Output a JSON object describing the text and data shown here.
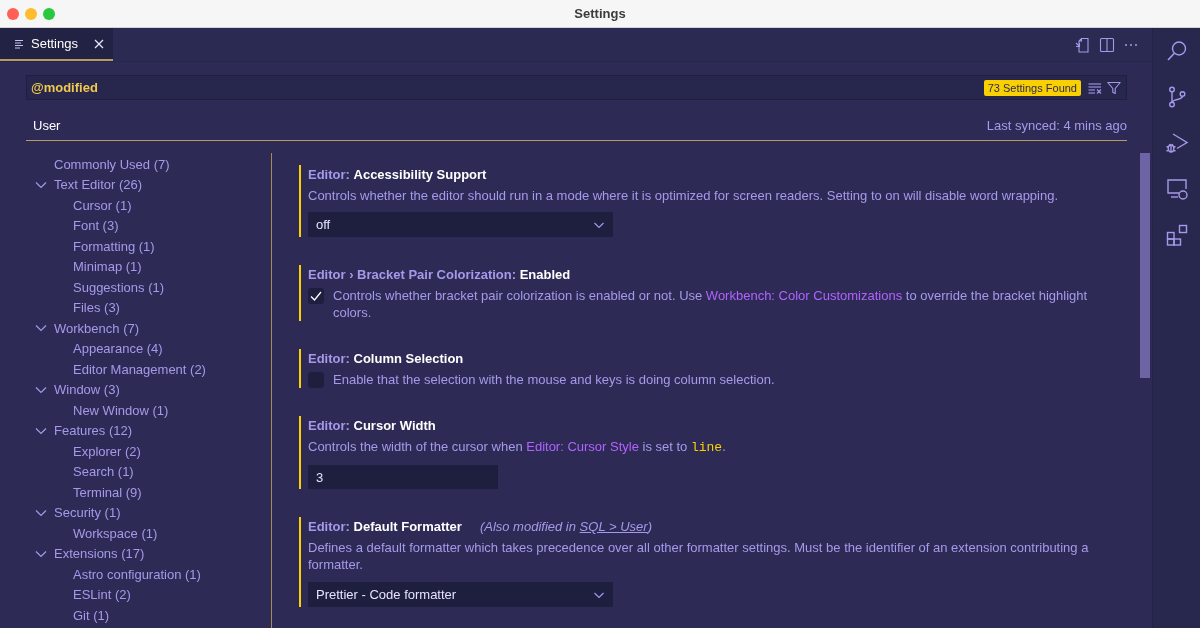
{
  "window": {
    "title": "Settings"
  },
  "tabs": [
    {
      "label": "Settings",
      "selected": true
    }
  ],
  "search": {
    "value": "@modified",
    "badge": "73 Settings Found"
  },
  "scope_tabs": [
    {
      "label": "User",
      "selected": true
    }
  ],
  "sync_status": "Last synced: 4 mins ago",
  "toc": [
    {
      "label": "Commonly Used (7)"
    },
    {
      "label": "Text Editor (26)",
      "expanded": true,
      "children": [
        {
          "label": "Cursor (1)"
        },
        {
          "label": "Font (3)"
        },
        {
          "label": "Formatting (1)"
        },
        {
          "label": "Minimap (1)"
        },
        {
          "label": "Suggestions (1)"
        },
        {
          "label": "Files (3)"
        }
      ]
    },
    {
      "label": "Workbench (7)",
      "expanded": true,
      "children": [
        {
          "label": "Appearance (4)"
        },
        {
          "label": "Editor Management (2)"
        }
      ]
    },
    {
      "label": "Window (3)",
      "expanded": true,
      "children": [
        {
          "label": "New Window (1)"
        }
      ]
    },
    {
      "label": "Features (12)",
      "expanded": true,
      "children": [
        {
          "label": "Explorer (2)"
        },
        {
          "label": "Search (1)"
        },
        {
          "label": "Terminal (9)"
        }
      ]
    },
    {
      "label": "Security (1)",
      "expanded": true,
      "children": [
        {
          "label": "Workspace (1)"
        }
      ]
    },
    {
      "label": "Extensions (17)",
      "expanded": true,
      "children": [
        {
          "label": "Astro configuration (1)"
        },
        {
          "label": "ESLint (2)"
        },
        {
          "label": "Git (1)"
        }
      ]
    }
  ],
  "settings": [
    {
      "kind": "select",
      "modified": true,
      "category": "Editor:",
      "name": "Accessibility Support",
      "description": [
        {
          "kind": "text",
          "text": "Controls whether the editor should run in a mode where it is optimized for screen readers. Setting to on will disable word wrapping."
        }
      ],
      "value": "off"
    },
    {
      "kind": "checkbox",
      "modified": true,
      "category": "Editor › Bracket Pair Colorization:",
      "name": "Enabled",
      "checked": true,
      "description": [
        {
          "kind": "text",
          "text": "Controls whether bracket pair colorization is enabled or not. Use "
        },
        {
          "kind": "link",
          "text": "Workbench: Color Customizations"
        },
        {
          "kind": "text",
          "text": " to override the bracket highlight colors."
        }
      ]
    },
    {
      "kind": "checkbox",
      "modified": true,
      "category": "Editor:",
      "name": "Column Selection",
      "checked": false,
      "description": [
        {
          "kind": "text",
          "text": "Enable that the selection with the mouse and keys is doing column selection."
        }
      ]
    },
    {
      "kind": "number",
      "modified": true,
      "category": "Editor:",
      "name": "Cursor Width",
      "description": [
        {
          "kind": "text",
          "text": "Controls the width of the cursor when "
        },
        {
          "kind": "link",
          "text": "Editor: Cursor Style"
        },
        {
          "kind": "text",
          "text": " is set to "
        },
        {
          "kind": "code",
          "text": "line"
        },
        {
          "kind": "text",
          "text": "."
        }
      ],
      "value": "3"
    },
    {
      "kind": "select",
      "modified": true,
      "category": "Editor:",
      "name": "Default Formatter",
      "note": [
        {
          "kind": "text",
          "text": "(Also modified in "
        },
        {
          "kind": "link",
          "text": "SQL > User"
        },
        {
          "kind": "text",
          "text": ")"
        }
      ],
      "description": [
        {
          "kind": "text",
          "text": "Defines a default formatter which takes precedence over all other formatter settings. Must be the identifier of an extension contributing a formatter."
        }
      ],
      "value": "Prettier - Code formatter"
    }
  ]
}
